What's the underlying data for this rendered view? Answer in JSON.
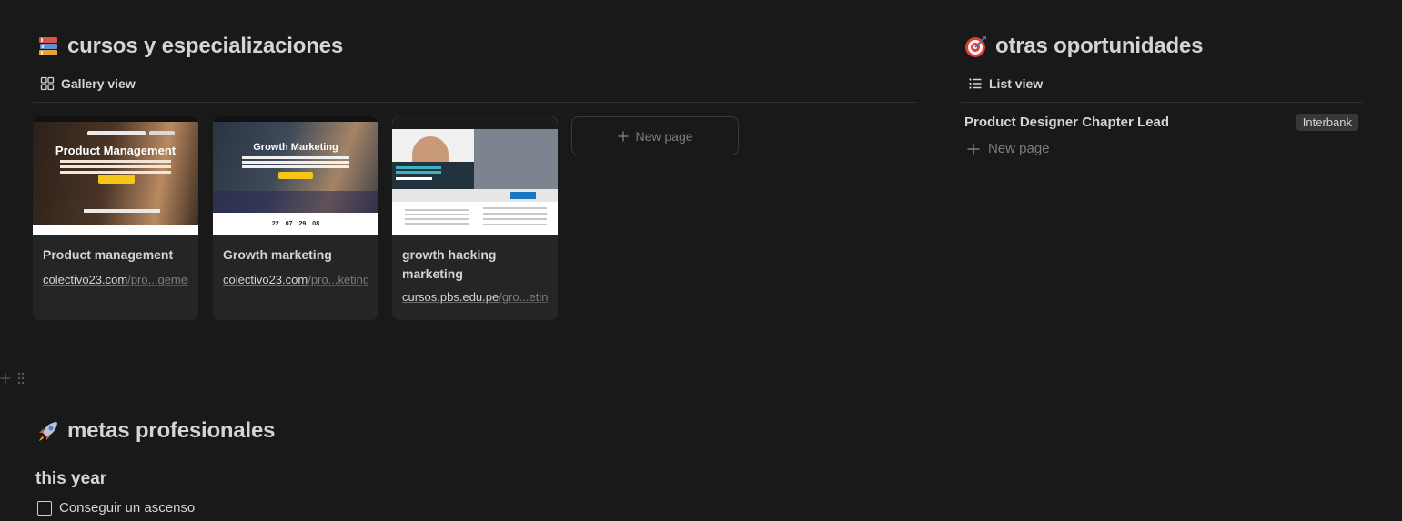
{
  "left_section": {
    "title": "cursos y especializaciones",
    "icon": "books-icon",
    "view_label": "Gallery view",
    "cards": [
      {
        "thumb_title": "Product Management",
        "title": "Product management",
        "url_domain": "colectivo23.com",
        "url_path": "/pro...gement"
      },
      {
        "thumb_title": "Growth Marketing",
        "title": "Growth marketing",
        "url_domain": "colectivo23.com",
        "url_path": "/pro...keting",
        "countdown": [
          "22",
          "07",
          "29",
          "08"
        ]
      },
      {
        "thumb_title": "",
        "title": "growth hacking marketing",
        "url_domain": "cursos.pbs.edu.pe",
        "url_path": "/gro...eting/"
      }
    ],
    "new_page_label": "New page"
  },
  "right_section": {
    "title": "otras oportunidades",
    "icon": "target-icon",
    "view_label": "List view",
    "items": [
      {
        "title": "Product Designer Chapter Lead",
        "tag": "Interbank"
      }
    ],
    "new_page_label": "New page"
  },
  "goals_section": {
    "title": "metas profesionales",
    "icon": "rocket-icon",
    "subheading": "this year",
    "todos": [
      {
        "label": "Conseguir un ascenso",
        "checked": false
      }
    ]
  },
  "colors": {
    "background": "#191919",
    "card": "#252525",
    "tag": "#373737",
    "text": "#d4d4d4",
    "muted": "#7d7d7d"
  }
}
